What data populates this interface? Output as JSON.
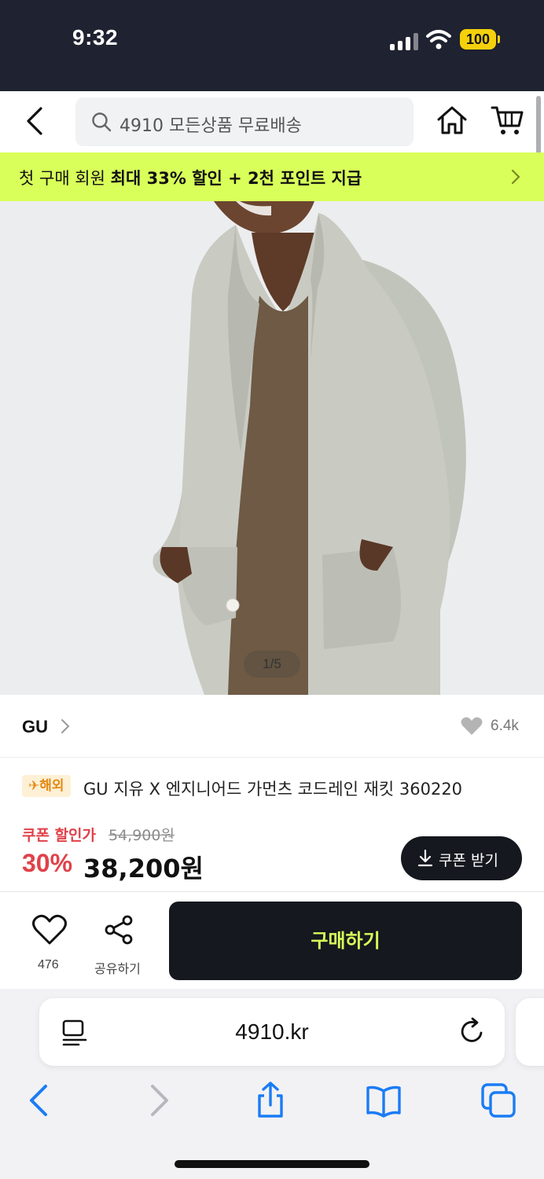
{
  "status_bar": {
    "time": "9:32",
    "battery": "100"
  },
  "header": {
    "search_placeholder": "4910 모든상품 무료배송"
  },
  "promo": {
    "prefix": "첫 구매 회원 ",
    "highlight": "최대 33% 할인 + 2천 포인트 지급"
  },
  "gallery": {
    "counter": "1/5"
  },
  "brand": {
    "name": "GU",
    "likes": "6.4k"
  },
  "product": {
    "badge": "✈해외",
    "title": "GU 지유 X 엔지니어드 가먼츠 코드레인 재킷 360220",
    "coupon_label": "쿠폰 할인가",
    "original_price": "54,900원",
    "discount_rate": "30%",
    "sale_price": "38,200원",
    "coupon_button": "쿠폰 받기"
  },
  "actions": {
    "wish_count": "476",
    "share_label": "공유하기",
    "buy_label": "구매하기"
  },
  "browser": {
    "url": "4910.kr"
  },
  "colors": {
    "accent_lime": "#d9ff5a",
    "dark": "#15181e",
    "sale_red": "#e0424a",
    "ios_blue": "#1a7cf5"
  }
}
